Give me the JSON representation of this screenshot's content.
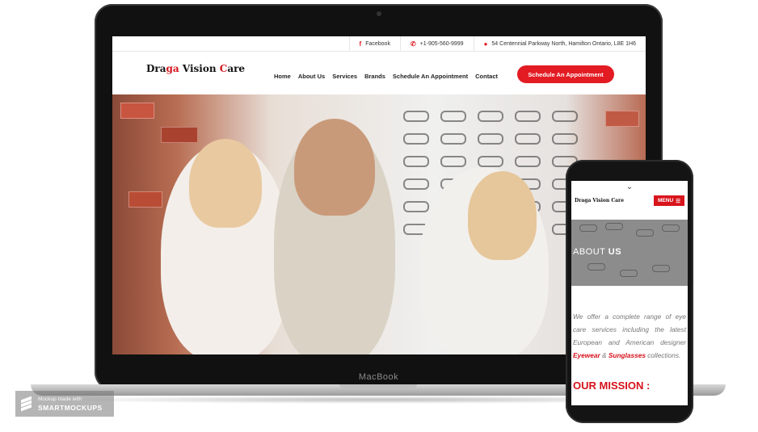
{
  "laptop": {
    "brand_label": "MacBook",
    "site": {
      "topbar": {
        "facebook": "Facebook",
        "phone": "+1-905-560-9999",
        "address": "54 Centennial Parkway North, Hamilton Ontario, L8E 1H6"
      },
      "logo": {
        "part1": "Dra",
        "part2": "ga ",
        "part3": "V",
        "part4": "ision ",
        "part5": "C",
        "part6": "are"
      },
      "nav": [
        "Home",
        "About Us",
        "Services",
        "Brands",
        "Schedule An Appointment",
        "Contact"
      ],
      "cta_label": "Schedule An Appointment"
    }
  },
  "phone": {
    "logo": "Draga Vision Care",
    "menu_label": "MENU",
    "banner_title_light": "ABOUT ",
    "banner_title_bold": "US",
    "about_text_start": "We offer a complete range of eye care services including the latest European and American designer ",
    "about_highlight_1": "Eyewear",
    "about_and": " & ",
    "about_highlight_2": "Sunglasses",
    "about_text_end": " collections.",
    "mission_heading": "OUR MISSION :"
  },
  "watermark": {
    "small_text": "Mockup made with",
    "brand": "SMARTMOCKUPS"
  },
  "colors": {
    "accent_red": "#e31b23",
    "text_dark": "#222222",
    "banner_gray": "#8c8c8c"
  },
  "icons": [
    "facebook-icon",
    "phone-icon",
    "location-pin-icon",
    "hamburger-icon",
    "chevron-down-icon",
    "smartmockups-logo-icon"
  ]
}
